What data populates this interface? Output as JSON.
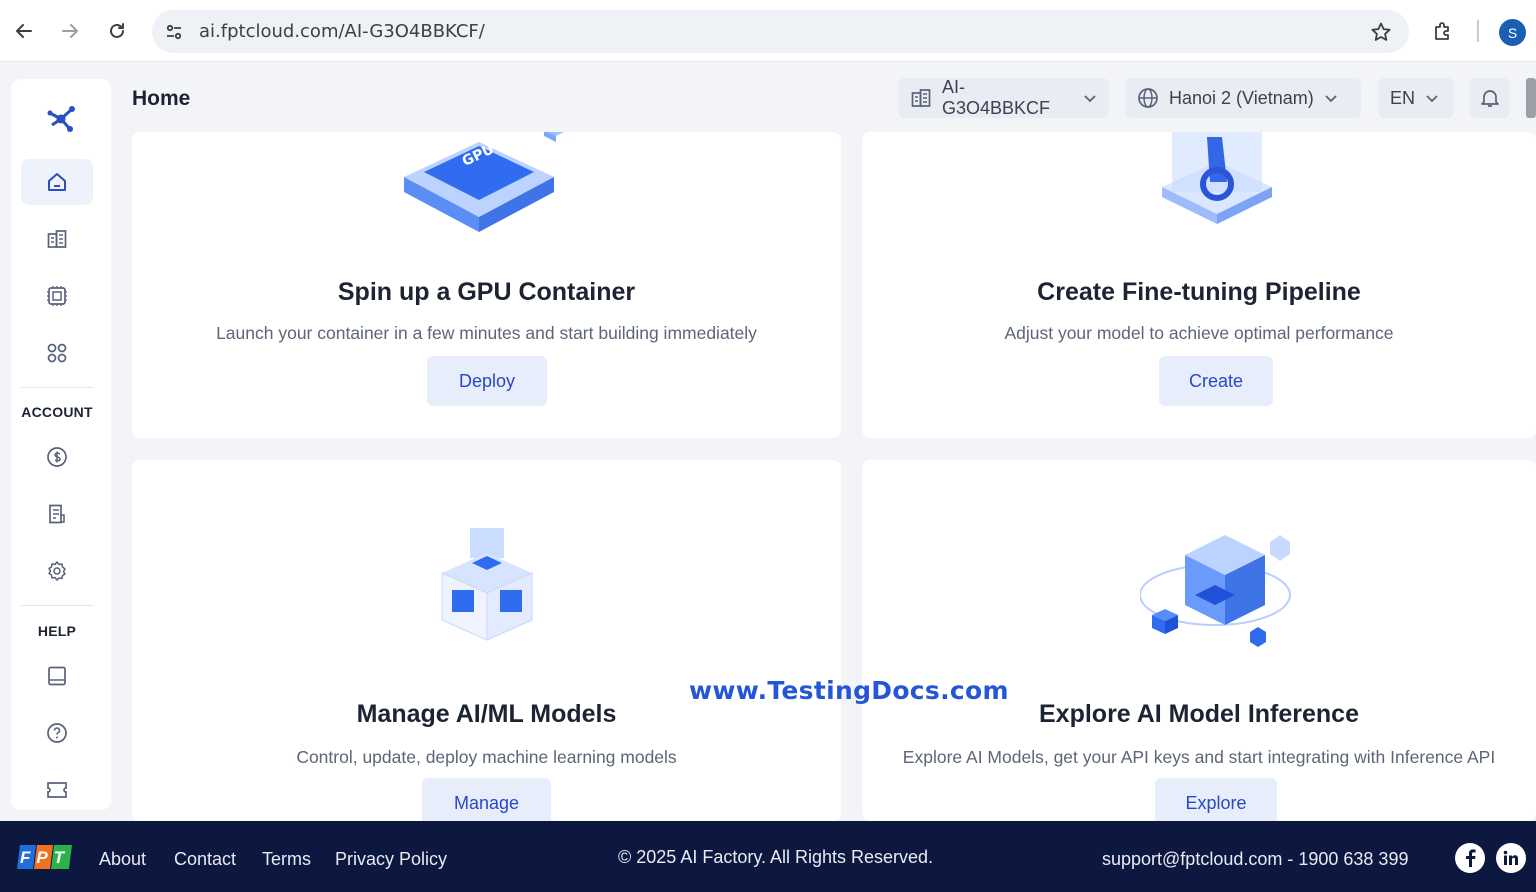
{
  "browser": {
    "url": "ai.fptcloud.com/AI-G3O4BBKCF/",
    "profile_initial": "S"
  },
  "sidebar": {
    "account_heading": "ACCOUNT",
    "help_heading": "HELP"
  },
  "topbar": {
    "title": "Home",
    "project_select": "AI-G3O4BBKCF",
    "region_select": "Hanoi 2 (Vietnam)",
    "language_select": "EN"
  },
  "cards": [
    {
      "title": "Spin up a GPU Container",
      "description": "Launch your container in a few minutes and start building immediately",
      "button": "Deploy",
      "illustration_text": "GPU"
    },
    {
      "title": "Create Fine-tuning Pipeline",
      "description": "Adjust your model to achieve optimal performance",
      "button": "Create"
    },
    {
      "title": "Manage AI/ML Models",
      "description": "Control, update, deploy machine learning models",
      "button": "Manage"
    },
    {
      "title": "Explore AI Model Inference",
      "description": "Explore AI Models, get your API keys and start integrating with Inference API",
      "button": "Explore"
    }
  ],
  "watermark": "www.TestingDocs.com",
  "footer": {
    "logo_text": "FPT",
    "links": [
      "About",
      "Contact",
      "Terms",
      "Privacy Policy"
    ],
    "copyright": "© 2025 AI Factory. All Rights Reserved.",
    "support": "support@fptcloud.com - 1900 638 399"
  },
  "colors": {
    "accent": "#2747c7",
    "footer_bg": "#0c1840",
    "button_bg": "#e8edfb"
  }
}
